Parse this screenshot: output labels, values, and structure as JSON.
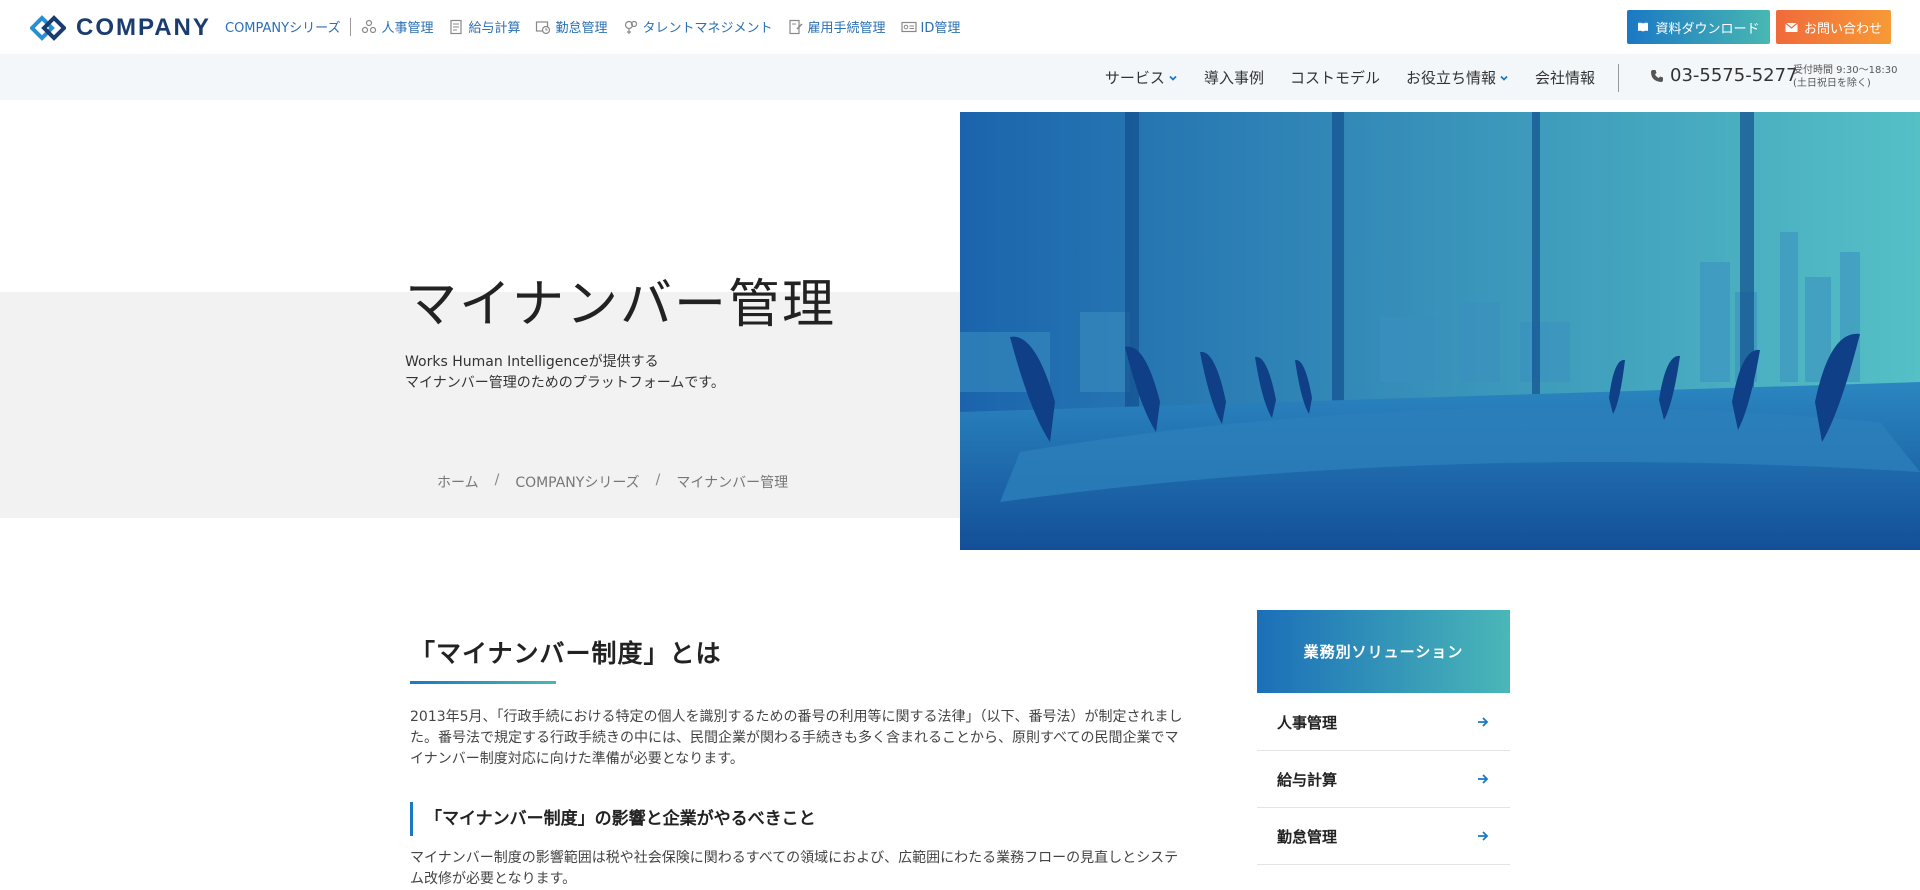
{
  "brand": {
    "name": "COMPANY"
  },
  "series_nav": {
    "series_link": "COMPANYシリーズ",
    "items": [
      {
        "label": "人事管理",
        "icon": "people-icon"
      },
      {
        "label": "給与計算",
        "icon": "document-icon"
      },
      {
        "label": "勤怠管理",
        "icon": "clock-icon"
      },
      {
        "label": "タレントマネジメント",
        "icon": "talent-icon"
      },
      {
        "label": "雇用手続管理",
        "icon": "form-icon"
      },
      {
        "label": "ID管理",
        "icon": "id-card-icon"
      }
    ]
  },
  "top_buttons": {
    "download": "資料ダウンロード",
    "contact": "お問い合わせ"
  },
  "main_nav": {
    "items": [
      "サービス",
      "導入事例",
      "コストモデル",
      "お役立ち情報",
      "会社情報"
    ],
    "phone": "03-5575-5277",
    "hours_line1": "受付時間 9:30〜18:30",
    "hours_line2": "(土日祝日を除く)"
  },
  "hero": {
    "title": "マイナンバー管理",
    "desc_line1": "Works Human Intelligenceが提供する",
    "desc_line2": "マイナンバー管理のためのプラットフォームです。"
  },
  "breadcrumb": {
    "home": "ホーム",
    "series": "COMPANYシリーズ",
    "current": "マイナンバー管理"
  },
  "content": {
    "title": "「マイナンバー制度」とは",
    "para1": "2013年5月、「行政手続における特定の個人を識別するための番号の利用等に関する法律」（以下、番号法）が制定されました。番号法で規定する行政手続きの中には、民間企業が関わる手続きも多く含まれることから、原則すべての民間企業でマイナンバー制度対応に向けた準備が必要となります。",
    "subtitle": "「マイナンバー制度」の影響と企業がやるべきこと",
    "para2": "マイナンバー制度の影響範囲は税や社会保険に関わるすべての領域におよび、広範囲にわたる業務フローの見直しとシステム改修が必要となります。"
  },
  "sidebar": {
    "heading": "業務別ソリューション",
    "items": [
      "人事管理",
      "給与計算",
      "勤怠管理"
    ]
  },
  "colors": {
    "brand_blue": "#1b78c4",
    "accent_teal": "#48b8b2",
    "contact_orange": "#f06a3a"
  }
}
